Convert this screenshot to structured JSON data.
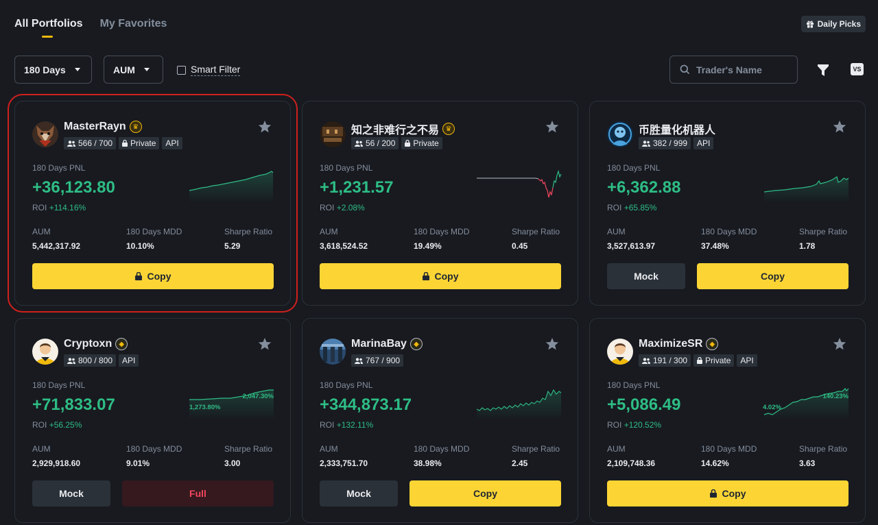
{
  "tabs": [
    "All Portfolios",
    "My Favorites"
  ],
  "daily_picks": "Daily Picks",
  "filters": {
    "period": "180 Days",
    "sort": "AUM",
    "smart_filter": "Smart Filter",
    "search_placeholder": "Trader's Name",
    "vs": "VS"
  },
  "labels": {
    "pnl": "180 Days PNL",
    "roi": "ROI",
    "aum": "AUM",
    "mdd": "180 Days MDD",
    "sharpe": "Sharpe Ratio",
    "copy": "Copy",
    "mock": "Mock",
    "full": "Full",
    "private": "Private",
    "api": "API"
  },
  "colors": {
    "background": "#181a20",
    "accent": "#fcd535",
    "positive": "#2ebd85",
    "negative": "#f6465d",
    "highlight_frame": "#d0201c"
  },
  "cards": [
    {
      "name": "MasterRayn",
      "badge": "gold",
      "copiers": "566 / 700",
      "private": true,
      "api": true,
      "pnl": "+36,123.80",
      "roi": "+114.16%",
      "aum": "5,442,317.92",
      "mdd": "10.10%",
      "sharpe": "5.29",
      "buttons": [
        "copy-locked"
      ],
      "highlighted": true,
      "chart_labels": []
    },
    {
      "name": "知之非难行之不易",
      "badge": "gold",
      "copiers": "56 / 200",
      "private": true,
      "api": false,
      "pnl": "+1,231.57",
      "roi": "+2.08%",
      "aum": "3,618,524.52",
      "mdd": "19.49%",
      "sharpe": "0.45",
      "buttons": [
        "copy-locked"
      ],
      "chart_labels": []
    },
    {
      "name": "币胜量化机器人",
      "badge": "none",
      "copiers": "382 / 999",
      "private": false,
      "api": true,
      "pnl": "+6,362.88",
      "roi": "+65.85%",
      "aum": "3,527,613.97",
      "mdd": "37.48%",
      "sharpe": "1.78",
      "buttons": [
        "mock",
        "copy"
      ],
      "chart_labels": []
    },
    {
      "name": "Cryptoxn",
      "badge": "grey",
      "copiers": "800 / 800",
      "private": false,
      "api": true,
      "pnl": "+71,833.07",
      "roi": "+56.25%",
      "aum": "2,929,918.60",
      "mdd": "9.01%",
      "sharpe": "3.00",
      "buttons": [
        "mock",
        "full"
      ],
      "chart_labels": [
        "1,273.80%",
        "2,047.30%"
      ]
    },
    {
      "name": "MarinaBay",
      "badge": "grey",
      "copiers": "767 / 900",
      "private": false,
      "api": false,
      "pnl": "+344,873.17",
      "roi": "+132.11%",
      "aum": "2,333,751.70",
      "mdd": "38.98%",
      "sharpe": "2.45",
      "buttons": [
        "mock",
        "copy"
      ],
      "chart_labels": []
    },
    {
      "name": "MaximizeSR",
      "badge": "grey",
      "copiers": "191 / 300",
      "private": true,
      "api": true,
      "pnl": "+5,086.49",
      "roi": "+120.52%",
      "aum": "2,109,748.36",
      "mdd": "14.62%",
      "sharpe": "3.63",
      "buttons": [
        "copy-locked"
      ],
      "chart_labels": [
        "4.02%",
        "140.23%"
      ]
    }
  ]
}
